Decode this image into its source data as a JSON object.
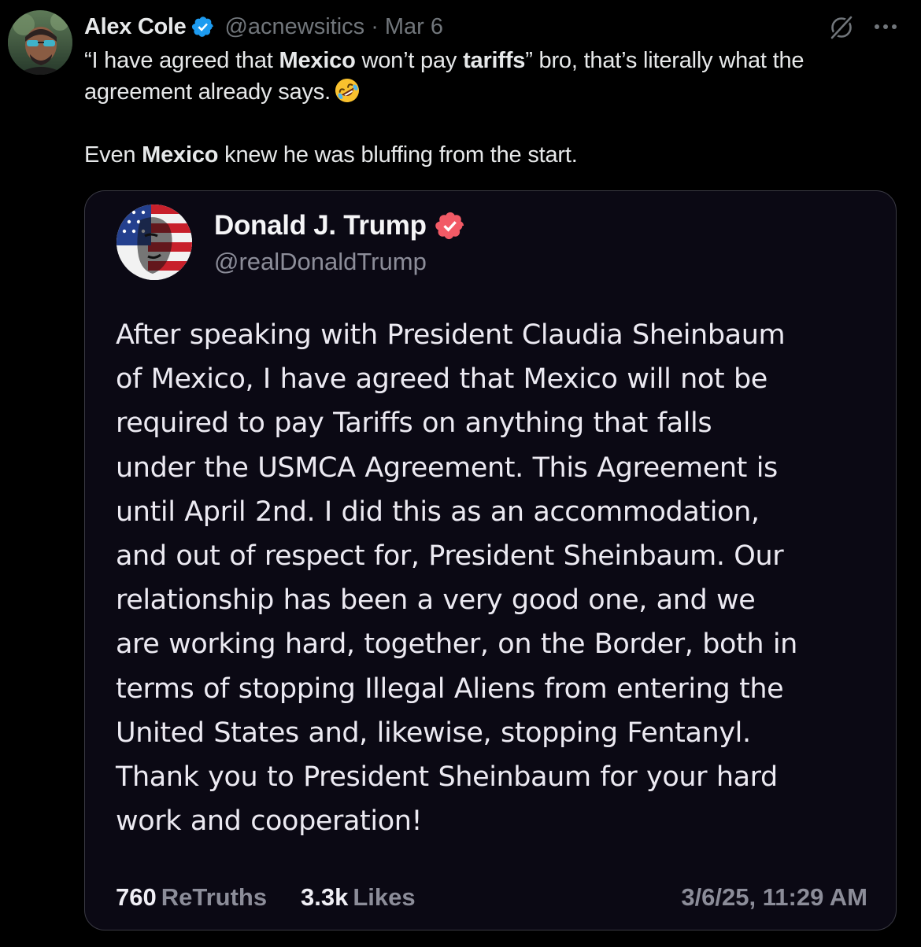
{
  "post": {
    "author_name": "Alex Cole",
    "handle": "@acnewsitics",
    "separator": "·",
    "date": "Mar 6",
    "text": {
      "line1_q_open": "“I have agreed that ",
      "line1_b1": "Mexico",
      "line1_mid": " won’t pay ",
      "line1_b2": "tariffs",
      "line1_rest": "” bro, that’s literally what the agreement already says.",
      "line2_start": "Even ",
      "line2_b": "Mexico",
      "line2_rest": " knew he was bluffing from the start."
    },
    "emoji": "rolling-on-floor-laughing-emoji"
  },
  "quoted": {
    "author_name": "Donald J. Trump",
    "handle": "@realDonaldTrump",
    "body": [
      "After speaking with President Claudia Sheinbaum",
      "of Mexico, I have agreed that Mexico will not be",
      "required to pay Tariffs on anything that falls",
      "under the USMCA Agreement. This Agreement is",
      "until April 2nd. I did this as an accommodation,",
      "and out of respect for, President Sheinbaum. Our",
      "relationship has been a very good one, and we",
      "are working hard, together, on the Border, both in",
      "terms of stopping Illegal Aliens from entering the",
      "United States and, likewise, stopping Fentanyl.",
      "Thank you to President Sheinbaum for your hard",
      "work and cooperation!"
    ],
    "retruths_count": "760",
    "retruths_label": "ReTruths",
    "likes_count": "3.3k",
    "likes_label": "Likes",
    "timestamp": "3/6/25, 11:29 AM"
  },
  "colors": {
    "background": "#000000",
    "verified_blue": "#1d9bf0",
    "truth_badge": "#f25a66",
    "muted": "#71767b"
  }
}
